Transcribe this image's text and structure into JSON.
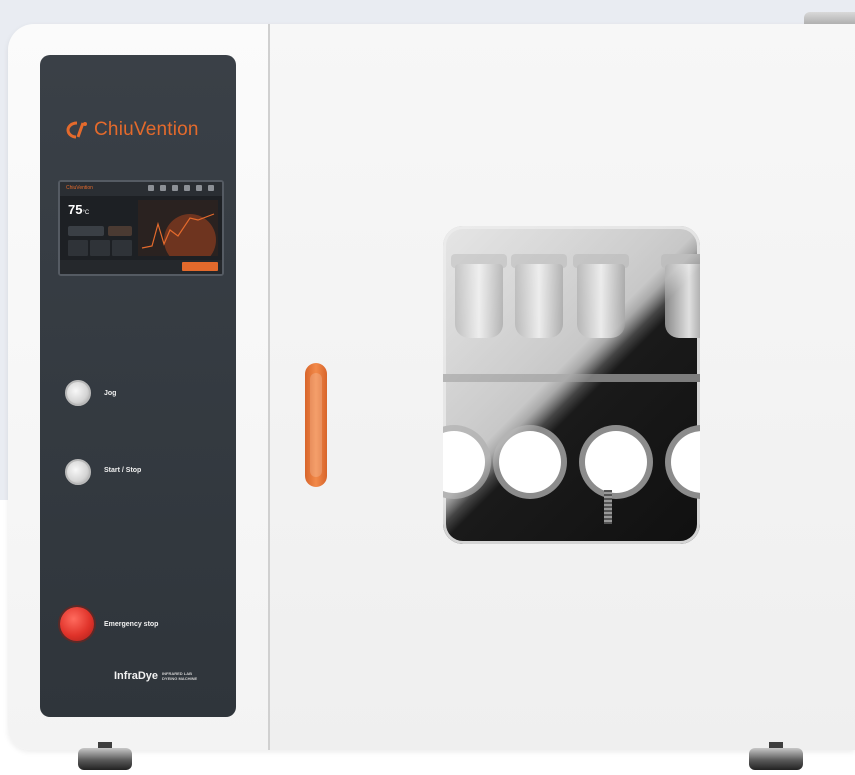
{
  "brand": {
    "name": "ChiuVention",
    "accent_color": "#e46a2c"
  },
  "screen": {
    "temperature": "75",
    "temperature_unit": "°C"
  },
  "controls": {
    "jog_label": "Jog",
    "start_stop_label": "Start / Stop",
    "emergency_label": "Emergency stop",
    "emergency_color": "#e0332a"
  },
  "product": {
    "name": "InfraDye",
    "subtitle": "INFRARED LAB DYEING MACHINE"
  },
  "door": {
    "handle_color": "#e46a2c"
  }
}
